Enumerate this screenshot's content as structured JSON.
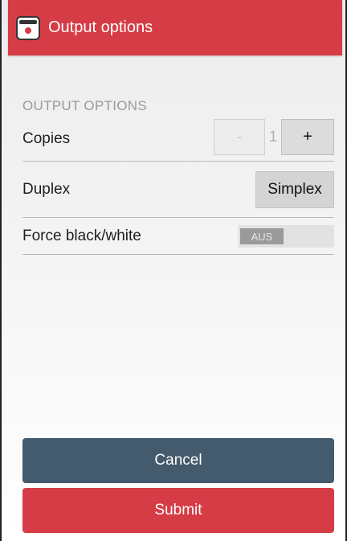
{
  "appbar": {
    "title": "Output options",
    "icon": "printer-app-icon",
    "color": "#d63c45"
  },
  "section": {
    "header": "OUTPUT OPTIONS"
  },
  "copies": {
    "label": "Copies",
    "minus_label": "-",
    "value": "1",
    "plus_label": "+"
  },
  "duplex": {
    "label": "Duplex",
    "value": "Simplex"
  },
  "force_bw": {
    "label": "Force black/white",
    "toggle_text": "AUS"
  },
  "actions": {
    "cancel_label": "Cancel",
    "submit_label": "Submit",
    "cancel_color": "#445a6d",
    "submit_color": "#d63c45"
  }
}
